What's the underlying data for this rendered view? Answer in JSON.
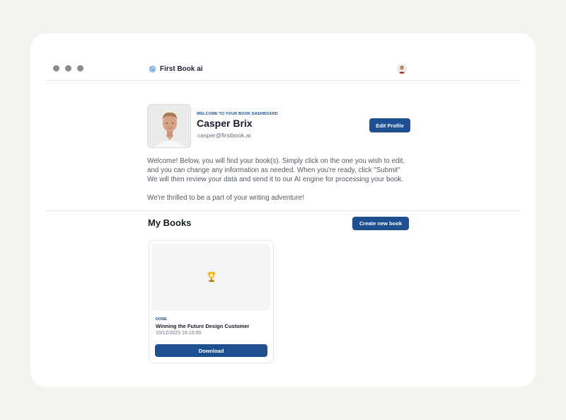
{
  "colors": {
    "accent": "#1d4f91",
    "background": "#f4f3ee",
    "panel": "#ffffff"
  },
  "window": {
    "controls": [
      "window-dot",
      "window-dot",
      "window-dot"
    ]
  },
  "header": {
    "logo_icon": "brain-icon",
    "app_name": "First Book ai",
    "avatar": "user-avatar"
  },
  "profile": {
    "kicker": "WELCOME TO YOUR BOOK DASHBOARD",
    "name": "Casper Brix",
    "email": "casper@firstbook.ai",
    "edit_label": "Edit Profile"
  },
  "intro": {
    "lines": [
      "Welcome! Below, you will find your book(s). Simply click on the one you wish to edit,",
      "and you can change any information as needed. When you're ready, click \"Submit\"",
      "We will then review your data and send it to our AI engine for processing your book."
    ],
    "closing": "We're thrilled to be a part of your writing adventure!"
  },
  "books_section": {
    "title": "My Books",
    "create_label": "Create new book",
    "books": [
      {
        "cover_icon": "trophy-icon",
        "status": "DONE",
        "title": "Winning the Future Design Customer",
        "date": "10/12/2023 16:10:00",
        "download_label": "Download"
      }
    ]
  }
}
